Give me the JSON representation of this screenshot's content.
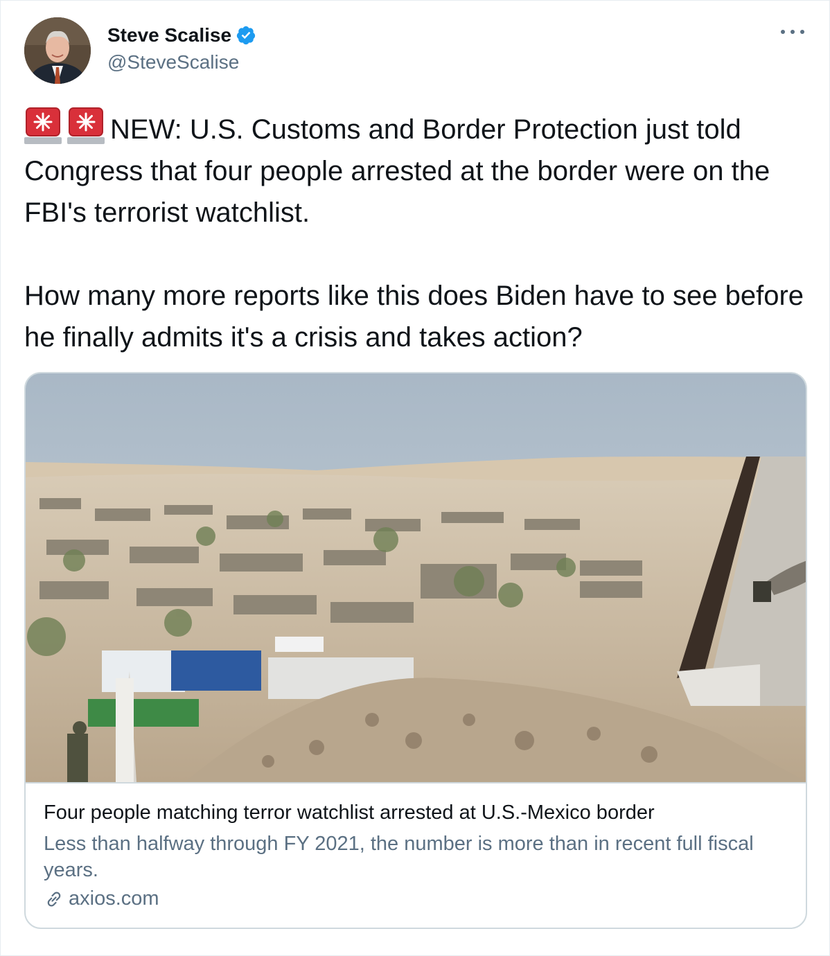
{
  "author": {
    "display_name": "Steve Scalise",
    "handle": "@SteveScalise",
    "verified": true,
    "avatar_icon": "avatar-photo"
  },
  "menu": {
    "icon": "more-icon"
  },
  "tweet": {
    "emoji_icons": [
      "police-light-icon",
      "police-light-icon"
    ],
    "paragraph1": "NEW: U.S. Customs and Border Protection just told Congress that four people arrested at the border were on the FBI's terrorist watchlist.",
    "paragraph2": "How many more reports like this does Biden have to see before he finally admits it's a crisis and takes action?"
  },
  "card": {
    "image_icon": "border-landscape-photo",
    "title": "Four people matching terror watchlist arrested at U.S.-Mexico border",
    "description": "Less than halfway through FY 2021, the number is more than in recent full fiscal years.",
    "domain": "axios.com",
    "domain_icon": "link-icon"
  },
  "colors": {
    "accent": "#1d9bf0",
    "text": "#0f1419",
    "secondary": "#5b7083",
    "border": "#cfd9de",
    "siren_red": "#d9303a"
  }
}
